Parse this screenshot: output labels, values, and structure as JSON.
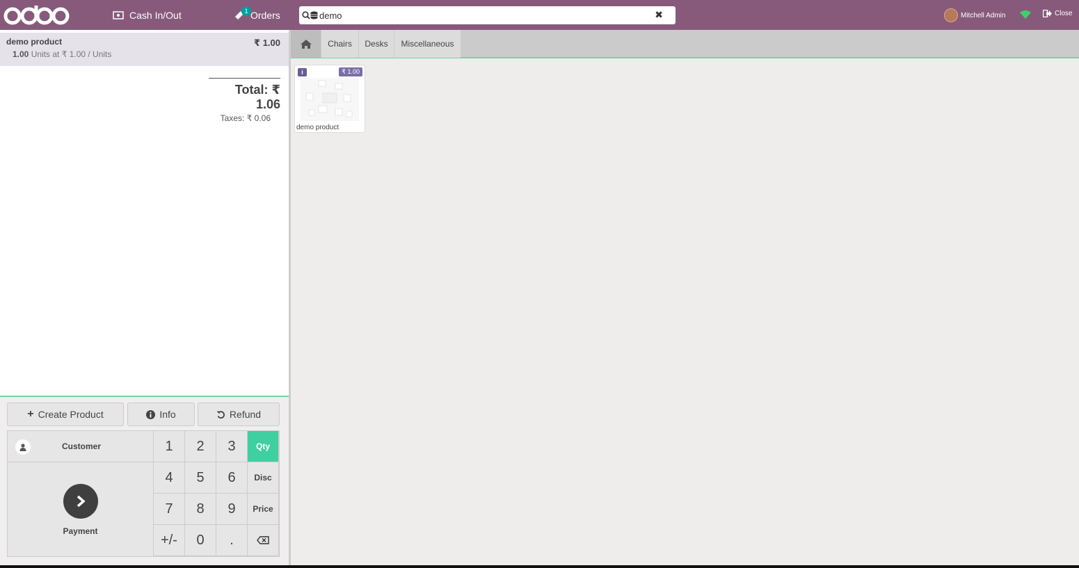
{
  "topbar": {
    "logo_text": "odoo",
    "cash_label": "Cash In/Out",
    "orders_label": "Orders",
    "orders_badge": "1",
    "search_value": "demo",
    "user_name": "Mitchell Admin",
    "close_label": "Close",
    "wifi_color": "#3fcf6a"
  },
  "order": {
    "line": {
      "name": "demo product",
      "price": "₹ 1.00",
      "qty": "1.00",
      "detail": "Units at ₹ 1.00 / Units"
    },
    "total": "Total: ₹ 1.06",
    "taxes": "Taxes: ₹ 0.06"
  },
  "controls": {
    "create_product": "Create Product",
    "info": "Info",
    "refund": "Refund"
  },
  "actionpad": {
    "customer": "Customer",
    "payment": "Payment"
  },
  "numpad": {
    "k1": "1",
    "k2": "2",
    "k3": "3",
    "qty": "Qty",
    "k4": "4",
    "k5": "5",
    "k6": "6",
    "disc": "Disc",
    "k7": "7",
    "k8": "8",
    "k9": "9",
    "price": "Price",
    "plusminus": "+/-",
    "k0": "0",
    "dot": ".",
    "active_mode": "Qty"
  },
  "categories": {
    "tabs": [
      "Chairs",
      "Desks",
      "Miscellaneous"
    ]
  },
  "products": [
    {
      "name": "demo product",
      "price": "₹ 1.00"
    }
  ],
  "colors": {
    "brand": "#875a7b",
    "accent": "#3fcfa0"
  }
}
